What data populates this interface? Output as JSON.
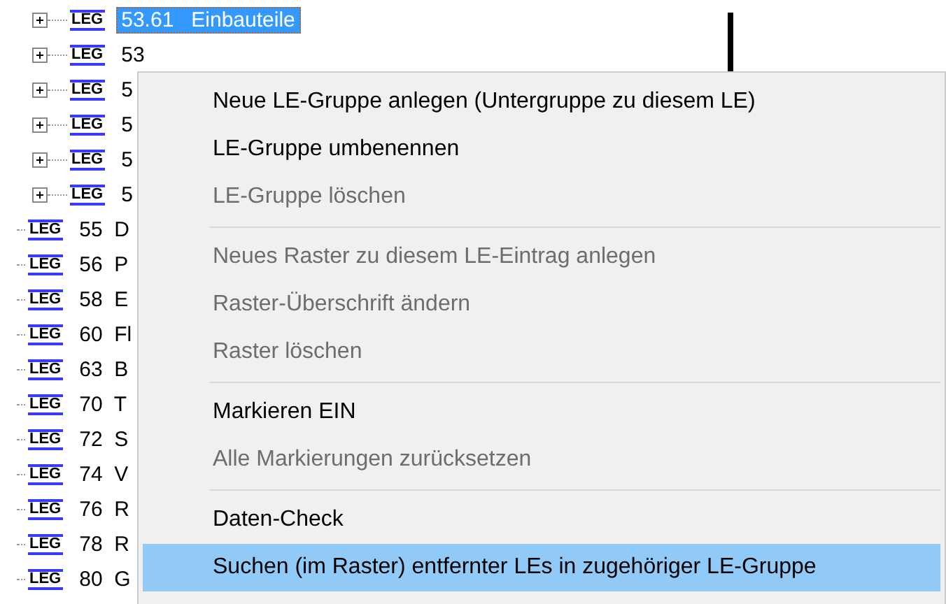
{
  "tree": {
    "items": [
      {
        "badge": "LEG",
        "text": "53.61   Einbauteile",
        "selected": true,
        "expandable": true
      },
      {
        "badge": "LEG",
        "text": "53",
        "selected": false,
        "expandable": true
      },
      {
        "badge": "LEG",
        "text": "5",
        "selected": false,
        "expandable": true
      },
      {
        "badge": "LEG",
        "text": "5",
        "selected": false,
        "expandable": true
      },
      {
        "badge": "LEG",
        "text": "5",
        "selected": false,
        "expandable": true
      },
      {
        "badge": "LEG",
        "text": "5",
        "selected": false,
        "expandable": true
      },
      {
        "badge": "LEG",
        "text": "55  D",
        "selected": false,
        "expandable": false
      },
      {
        "badge": "LEG",
        "text": "56  P",
        "selected": false,
        "expandable": false
      },
      {
        "badge": "LEG",
        "text": "58  E",
        "selected": false,
        "expandable": false
      },
      {
        "badge": "LEG",
        "text": "60  Fl",
        "selected": false,
        "expandable": false
      },
      {
        "badge": "LEG",
        "text": "63  B",
        "selected": false,
        "expandable": false
      },
      {
        "badge": "LEG",
        "text": "70  T",
        "selected": false,
        "expandable": false
      },
      {
        "badge": "LEG",
        "text": "72  S",
        "selected": false,
        "expandable": false
      },
      {
        "badge": "LEG",
        "text": "74  V",
        "selected": false,
        "expandable": false
      },
      {
        "badge": "LEG",
        "text": "76  R",
        "selected": false,
        "expandable": false
      },
      {
        "badge": "LEG",
        "text": "78  R",
        "selected": false,
        "expandable": false
      },
      {
        "badge": "LEG",
        "text": "80  G",
        "selected": false,
        "expandable": false
      }
    ]
  },
  "context_menu": {
    "groups": [
      [
        {
          "label": "Neue LE-Gruppe anlegen (Untergruppe zu diesem LE)",
          "disabled": false,
          "selected": false
        },
        {
          "label": "LE-Gruppe umbenennen",
          "disabled": false,
          "selected": false
        },
        {
          "label": "LE-Gruppe löschen",
          "disabled": true,
          "selected": false
        }
      ],
      [
        {
          "label": "Neues Raster zu diesem LE-Eintrag anlegen",
          "disabled": true,
          "selected": false
        },
        {
          "label": "Raster-Überschrift ändern",
          "disabled": true,
          "selected": false
        },
        {
          "label": "Raster löschen",
          "disabled": true,
          "selected": false
        }
      ],
      [
        {
          "label": "Markieren EIN",
          "disabled": false,
          "selected": false
        },
        {
          "label": "Alle Markierungen zurücksetzen",
          "disabled": true,
          "selected": false
        }
      ],
      [
        {
          "label": "Daten-Check",
          "disabled": false,
          "selected": false
        },
        {
          "label": "Suchen (im Raster) entfernter LEs in zugehöriger LE-Gruppe",
          "disabled": false,
          "selected": true
        }
      ]
    ]
  }
}
